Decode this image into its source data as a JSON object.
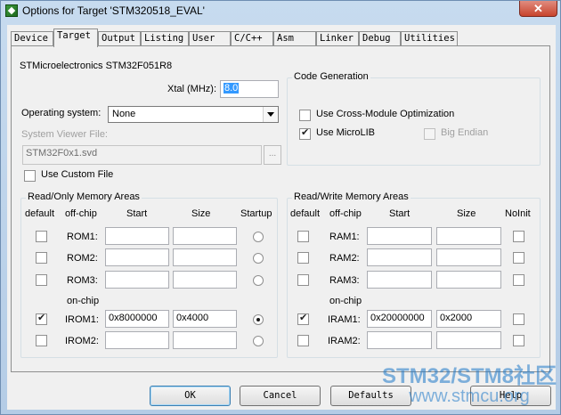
{
  "window": {
    "title": "Options for Target 'STM320518_EVAL'",
    "close_glyph": "✕"
  },
  "tabs": [
    {
      "label": "Device",
      "active": false
    },
    {
      "label": "Target",
      "active": true
    },
    {
      "label": "Output",
      "active": false
    },
    {
      "label": "Listing",
      "active": false
    },
    {
      "label": "User",
      "active": false
    },
    {
      "label": "C/C++",
      "active": false
    },
    {
      "label": "Asm",
      "active": false
    },
    {
      "label": "Linker",
      "active": false
    },
    {
      "label": "Debug",
      "active": false
    },
    {
      "label": "Utilities",
      "active": false
    }
  ],
  "target": {
    "device_name": "STMicroelectronics STM32F051R8",
    "xtal_label": "Xtal (MHz):",
    "xtal_value": "8.0",
    "os_label": "Operating system:",
    "os_value": "None",
    "svd_label": "System Viewer File:",
    "svd_value": "STM32F0x1.svd",
    "browse_label": "...",
    "custom_file_label": "Use Custom File",
    "custom_file_checked": false
  },
  "code_generation": {
    "title": "Code Generation",
    "cross_module_label": "Use Cross-Module Optimization",
    "cross_module_checked": false,
    "microlib_label": "Use MicroLIB",
    "microlib_checked": true,
    "big_endian_label": "Big Endian",
    "big_endian_checked": false
  },
  "rom": {
    "title": "Read/Only Memory Areas",
    "headers": {
      "default": "default",
      "offchip": "off-chip",
      "start": "Start",
      "size": "Size",
      "startup": "Startup"
    },
    "onchip_label": "on-chip",
    "rows": [
      {
        "label": "ROM1:",
        "start": "",
        "size": "",
        "default": false,
        "startup": false
      },
      {
        "label": "ROM2:",
        "start": "",
        "size": "",
        "default": false,
        "startup": false
      },
      {
        "label": "ROM3:",
        "start": "",
        "size": "",
        "default": false,
        "startup": false
      },
      {
        "label": "IROM1:",
        "start": "0x8000000",
        "size": "0x4000",
        "default": true,
        "startup": true
      },
      {
        "label": "IROM2:",
        "start": "",
        "size": "",
        "default": false,
        "startup": false
      }
    ]
  },
  "ram": {
    "title": "Read/Write Memory Areas",
    "headers": {
      "default": "default",
      "offchip": "off-chip",
      "start": "Start",
      "size": "Size",
      "noinit": "NoInit"
    },
    "onchip_label": "on-chip",
    "rows": [
      {
        "label": "RAM1:",
        "start": "",
        "size": "",
        "default": false,
        "noinit": false
      },
      {
        "label": "RAM2:",
        "start": "",
        "size": "",
        "default": false,
        "noinit": false
      },
      {
        "label": "RAM3:",
        "start": "",
        "size": "",
        "default": false,
        "noinit": false
      },
      {
        "label": "IRAM1:",
        "start": "0x20000000",
        "size": "0x2000",
        "default": true,
        "noinit": false
      },
      {
        "label": "IRAM2:",
        "start": "",
        "size": "",
        "default": false,
        "noinit": false
      }
    ]
  },
  "buttons": {
    "ok": "OK",
    "cancel": "Cancel",
    "defaults": "Defaults",
    "help": "Help"
  },
  "watermark": {
    "line1": "STM32/STM8社区",
    "line2": "www.stmcu.org"
  }
}
